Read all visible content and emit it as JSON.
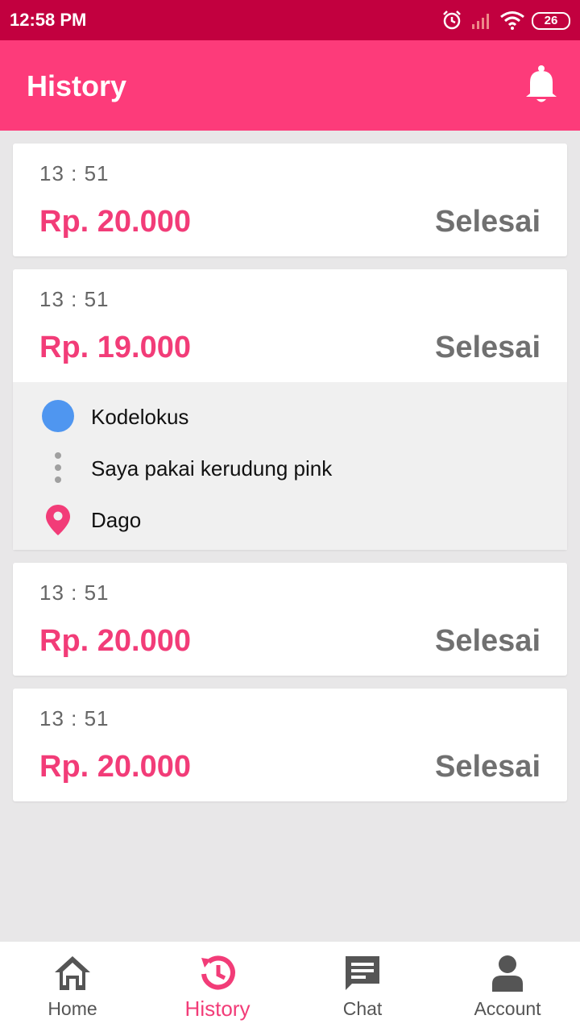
{
  "status_bar": {
    "time": "12:58 PM",
    "battery": "26"
  },
  "app_bar": {
    "title": "History"
  },
  "history": [
    {
      "time": "13 : 51",
      "price": "Rp. 20.000",
      "status": "Selesai"
    },
    {
      "time": "13 : 51",
      "price": "Rp. 19.000",
      "status": "Selesai",
      "details": {
        "origin": "Kodelokus",
        "note": "Saya pakai kerudung pink",
        "destination": "Dago"
      }
    },
    {
      "time": "13 : 51",
      "price": "Rp. 20.000",
      "status": "Selesai"
    },
    {
      "time": "13 : 51",
      "price": "Rp. 20.000",
      "status": "Selesai"
    }
  ],
  "bottom_nav": [
    {
      "label": "Home",
      "icon": "home-icon",
      "active": false
    },
    {
      "label": "History",
      "icon": "history-icon",
      "active": true
    },
    {
      "label": "Chat",
      "icon": "chat-icon",
      "active": false
    },
    {
      "label": "Account",
      "icon": "account-icon",
      "active": false
    }
  ],
  "colors": {
    "status_bar": "#c2003f",
    "app_bar": "#fd3b7a",
    "price": "#f23c78",
    "status_text": "#707070",
    "origin_dot": "#4f96f0"
  }
}
